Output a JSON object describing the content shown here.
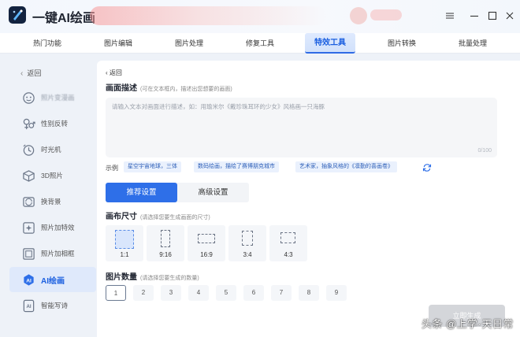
{
  "app": {
    "title": "一键AI绘画"
  },
  "topnav": {
    "tabs": [
      {
        "label": "热门功能"
      },
      {
        "label": "图片编辑"
      },
      {
        "label": "图片处理"
      },
      {
        "label": "修复工具"
      },
      {
        "label": "特效工具",
        "active": true
      },
      {
        "label": "图片转换"
      },
      {
        "label": "批量处理"
      }
    ]
  },
  "sidebar": {
    "back_label": "返回",
    "items": [
      {
        "label": "照片变漫画",
        "icon": "face-icon"
      },
      {
        "label": "性别反转",
        "icon": "gender-icon"
      },
      {
        "label": "时光机",
        "icon": "clock-icon"
      },
      {
        "label": "3D照片",
        "icon": "cube-icon"
      },
      {
        "label": "换背景",
        "icon": "image-swap-icon"
      },
      {
        "label": "照片加特效",
        "icon": "sparkle-frame-icon"
      },
      {
        "label": "照片加相框",
        "icon": "photo-frame-icon"
      },
      {
        "label": "AI绘画",
        "icon": "ai-icon",
        "active": true
      },
      {
        "label": "智能写诗",
        "icon": "ai-doc-icon"
      }
    ]
  },
  "main": {
    "back_label": "返回",
    "description": {
      "title": "画面描述",
      "hint": "(可在文本框内，描述出您想要的画面)",
      "placeholder": "请输入文本对画面进行描述，如：用瑜米尔《戴珍珠耳环的少女》风格画一只海豚",
      "counter": "0/100"
    },
    "examples": {
      "label": "示例",
      "chips": [
        "星空宇宙地球，三体",
        "数码绘画，描绘了赛博朋克城市",
        "艺术家，抽象风格的《凛勤的喜画卷》"
      ]
    },
    "modes": {
      "recommended": "推荐设置",
      "advanced": "高级设置"
    },
    "canvas": {
      "title": "画布尺寸",
      "hint": "(请选择您要生成画面的尺寸)",
      "ratios": [
        {
          "label": "1:1",
          "selected": true
        },
        {
          "label": "9:16"
        },
        {
          "label": "16:9"
        },
        {
          "label": "3:4"
        },
        {
          "label": "4:3"
        }
      ]
    },
    "count": {
      "title": "图片数量",
      "hint": "(请选择您要生成的数量)",
      "options": [
        "1",
        "2",
        "3",
        "4",
        "5",
        "6",
        "7",
        "8",
        "9"
      ],
      "selected": "1"
    },
    "generate_label": "立即生成"
  },
  "watermark": "头条 @上学·天日常",
  "colors": {
    "accent": "#2e6fe8",
    "active_tab_text": "#1b5fe0",
    "sidebar_active_bg": "#dfe9fb"
  }
}
